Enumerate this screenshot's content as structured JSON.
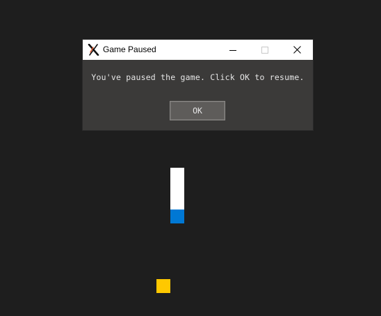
{
  "window": {
    "title": "Game Paused",
    "app_icon": "x-logo-icon",
    "controls": [
      "minimize-icon",
      "maximize-icon",
      "close-icon"
    ]
  },
  "dialog": {
    "message": "You've paused the game. Click OK to resume.",
    "ok_label": "OK"
  },
  "game": {
    "state": "paused",
    "snake_body_color": "#ffffff",
    "snake_head_color": "#0078d4",
    "food_color": "#ffc800",
    "background_color": "#1e1e1e"
  }
}
